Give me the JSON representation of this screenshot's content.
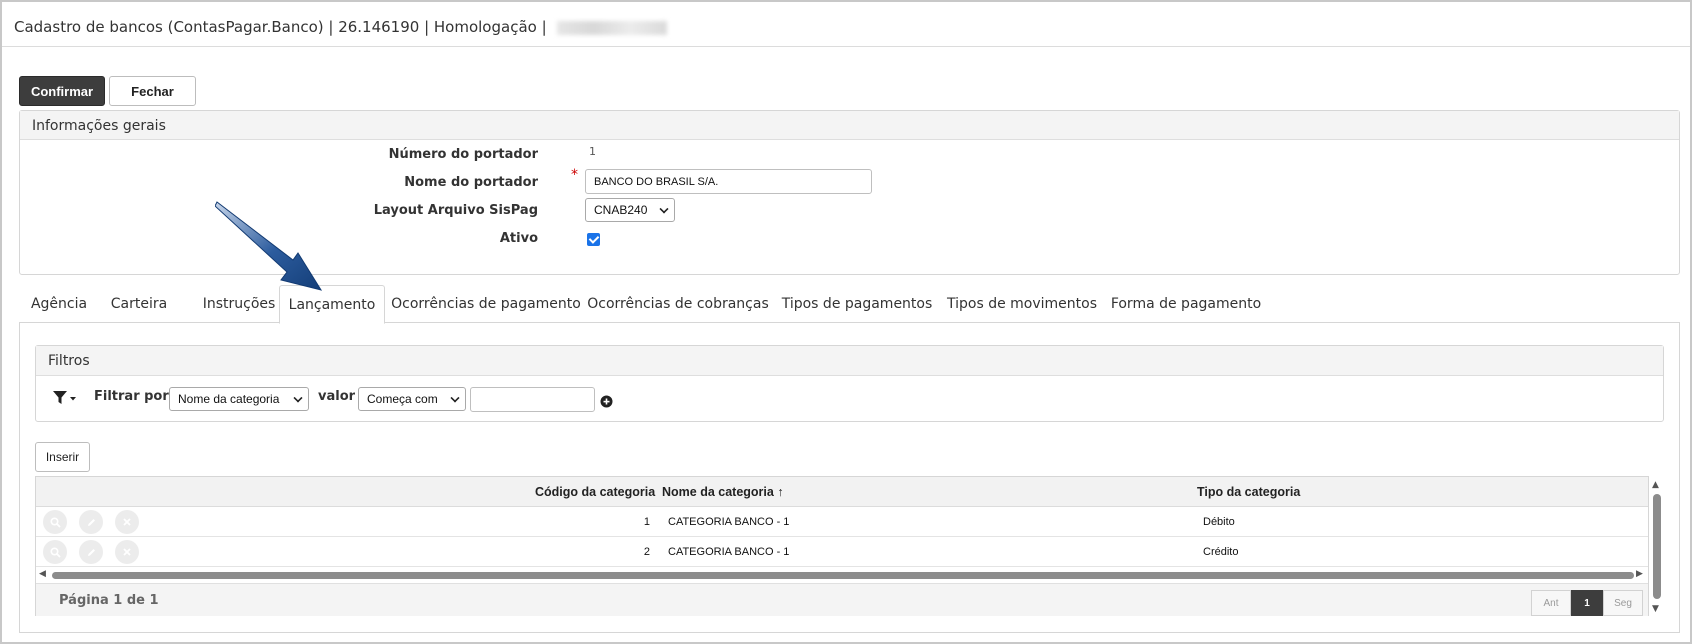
{
  "window": {
    "title": "Cadastro de bancos (ContasPagar.Banco) | 26.146190 | Homologação |"
  },
  "toolbar": {
    "confirm_label": "Confirmar",
    "close_label": "Fechar"
  },
  "general": {
    "title": "Informações gerais",
    "fields": {
      "numero_label": "Número do portador",
      "numero_value": "1",
      "nome_label": "Nome do portador",
      "nome_value": "BANCO DO BRASIL S/A.",
      "required_mark": "*",
      "layout_label": "Layout Arquivo SisPag",
      "layout_value": "CNAB240",
      "ativo_label": "Ativo",
      "ativo_checked": true
    }
  },
  "tabs": [
    {
      "label": "Agência"
    },
    {
      "label": "Carteira"
    },
    {
      "label": "Instruções"
    },
    {
      "label": "Lançamento",
      "active": true
    },
    {
      "label": "Ocorrências de pagamento"
    },
    {
      "label": "Ocorrências de cobranças"
    },
    {
      "label": "Tipos de pagamentos"
    },
    {
      "label": "Tipos de movimentos"
    },
    {
      "label": "Forma de pagamento"
    }
  ],
  "filters": {
    "title": "Filtros",
    "filter_by_label": "Filtrar por",
    "field_select": "Nome da categoria",
    "value_label": "valor",
    "operator_select": "Começa com",
    "value_input": ""
  },
  "grid": {
    "insert_label": "Inserir",
    "columns": {
      "codigo": "Código da categoria",
      "nome": "Nome da categoria",
      "tipo": "Tipo da categoria"
    },
    "sort_indicator": "↑",
    "rows": [
      {
        "codigo": "1",
        "nome": "CATEGORIA BANCO - 1",
        "tipo": "Débito"
      },
      {
        "codigo": "2",
        "nome": "CATEGORIA BANCO - 1",
        "tipo": "Crédito"
      }
    ],
    "page_info": "Página 1 de 1",
    "pager": {
      "prev": "Ant",
      "current": "1",
      "next": "Seg"
    }
  },
  "colors": {
    "primary_button": "#3d3d3d",
    "checkbox": "#1a73e8",
    "annotation_arrow": "#1f4e8c"
  }
}
